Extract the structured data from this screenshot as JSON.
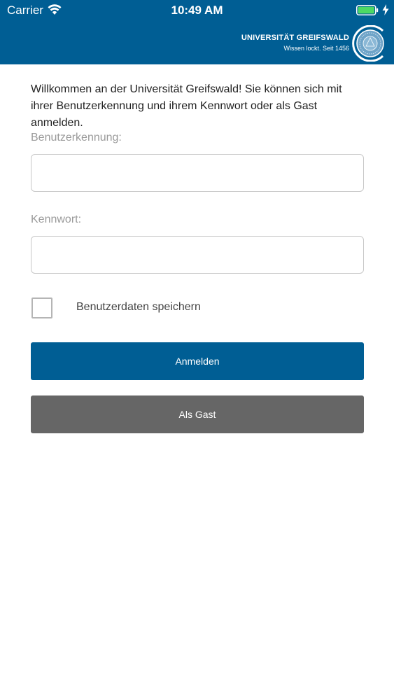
{
  "status_bar": {
    "carrier": "Carrier",
    "time": "10:49 AM"
  },
  "header": {
    "university_name": "UNIVERSITÄT GREIFSWALD",
    "motto": "Wissen lockt. Seit 1456",
    "seal_icon": "university-seal-icon"
  },
  "login": {
    "intro": "Willkommen an der Universität Greifswald! Sie können sich mit ihrer Benutzerkennung und ihrem Kennwort oder als Gast anmelden.",
    "username_label": "Benutzerkennung:",
    "username_value": "",
    "password_label": "Kennwort:",
    "password_value": "",
    "remember_label": "Benutzerdaten speichern",
    "remember_checked": false,
    "login_button": "Anmelden",
    "guest_button": "Als Gast"
  },
  "colors": {
    "brand_blue": "#005e94",
    "guest_gray": "#666666",
    "battery_green": "#4cd964"
  }
}
